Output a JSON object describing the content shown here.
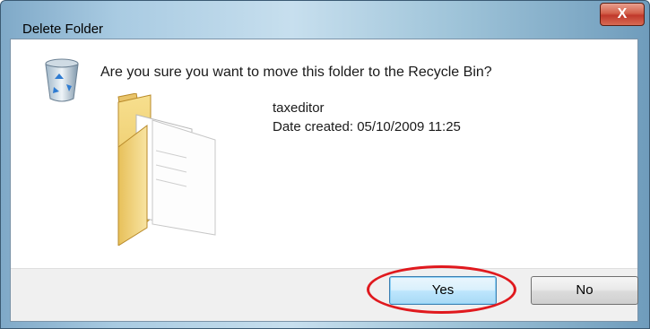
{
  "dialog": {
    "title": "Delete Folder",
    "close_label": "X",
    "question": "Are you sure you want to move this folder to the Recycle Bin?",
    "folder_name": "taxeditor",
    "date_created": "Date created: 05/10/2009 11:25",
    "buttons": {
      "yes": "Yes",
      "no": "No"
    },
    "icons": [
      "recycle-bin-icon",
      "folder-icon",
      "close-icon"
    ],
    "highlight_color": "#e0191e"
  }
}
